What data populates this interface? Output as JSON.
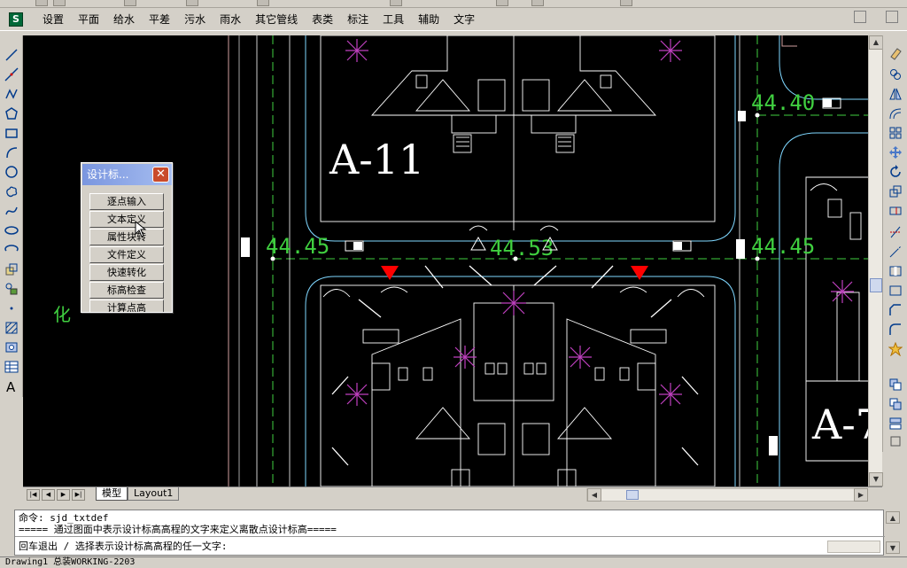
{
  "menu": {
    "items": [
      "设置",
      "平面",
      "给水",
      "平差",
      "污水",
      "雨水",
      "其它管线",
      "表类",
      "标注",
      "工具",
      "辅助",
      "文字"
    ]
  },
  "palette": {
    "title": "设计标...",
    "close_label": "✕",
    "buttons": [
      "逐点输入",
      "文本定义",
      "属性块转",
      "文件定义",
      "快速转化",
      "标高检查",
      "计算点高"
    ]
  },
  "drawing": {
    "building_label_1": "A-11",
    "building_label_2": "A-7",
    "elev_1": "44.40",
    "elev_2": "44.45",
    "elev_3": "44.53",
    "elev_4": "44.45",
    "side_text": "化"
  },
  "tabs": {
    "model": "模型",
    "layout1": "Layout1"
  },
  "command": {
    "line1": "命令: sjd_txtdef",
    "line2": "===== 通过图面中表示设计标高高程的文字来定义离散点设计标高=====",
    "line3": "回车退出 / 选择表示设计标高高程的任一文字:"
  },
  "status": {
    "text": "Drawing1 总装WORKING-2203"
  },
  "colors": {
    "canvas_bg": "#000000",
    "line_white": "#ffffff",
    "line_cyan": "#7fd7ff",
    "line_green": "#40d040",
    "marker_magenta": "#c040c0",
    "marker_red": "#ff0000",
    "palette_title": "#7a96df"
  },
  "icons": {
    "left_toolbar": [
      "line-icon",
      "construction-line-icon",
      "polyline-icon",
      "polygon-icon",
      "rectangle-icon",
      "arc-icon",
      "circle-icon",
      "revision-cloud-icon",
      "spline-icon",
      "ellipse-icon",
      "ellipse-arc-icon",
      "insert-block-icon",
      "make-block-icon",
      "point-icon",
      "hatch-icon",
      "region-icon",
      "table-icon",
      "text-icon"
    ],
    "right_toolbar": [
      "erase-icon",
      "copy-icon",
      "mirror-icon",
      "offset-icon",
      "array-icon",
      "move-icon",
      "rotate-icon",
      "scale-icon",
      "stretch-icon",
      "trim-icon",
      "extend-icon",
      "break-icon",
      "join-icon",
      "chamfer-icon",
      "fillet-icon",
      "explode-icon",
      "draworder-icon",
      "properties-icon"
    ]
  }
}
